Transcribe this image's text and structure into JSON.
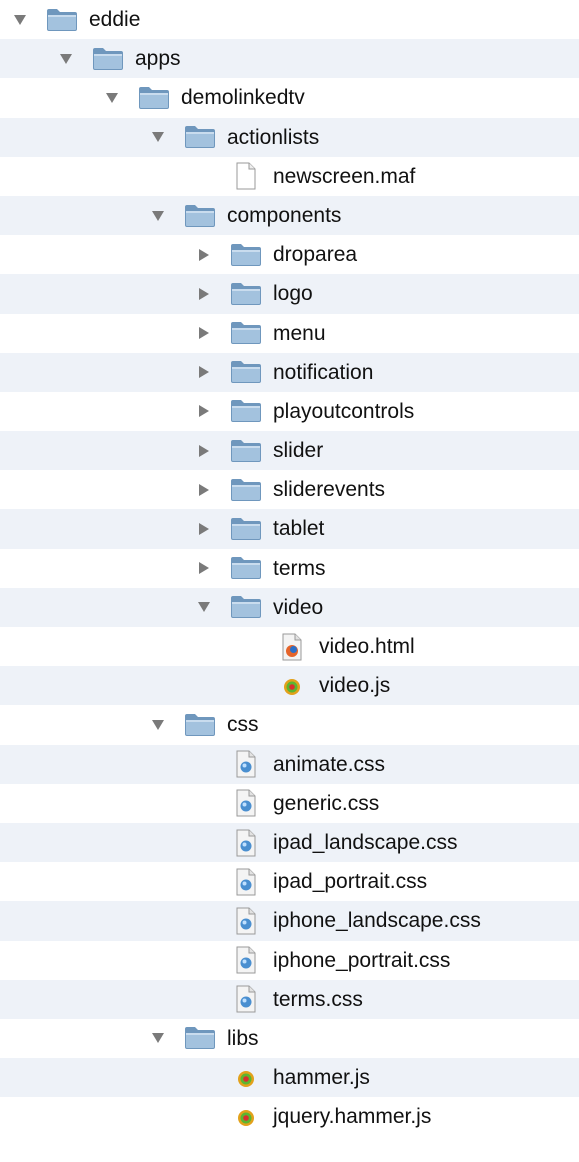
{
  "colors": {
    "row_alternate": "#eef2f8",
    "folder_fill": "#a3c2de",
    "folder_edge": "#6f97bd",
    "disclosure": "#7a7a7a"
  },
  "tree": [
    {
      "label": "eddie",
      "depth": 0,
      "kind": "folder",
      "expanded": true,
      "icon": "folder-icon"
    },
    {
      "label": "apps",
      "depth": 1,
      "kind": "folder",
      "expanded": true,
      "icon": "folder-icon"
    },
    {
      "label": "demolinkedtv",
      "depth": 2,
      "kind": "folder",
      "expanded": true,
      "icon": "folder-icon"
    },
    {
      "label": "actionlists",
      "depth": 3,
      "kind": "folder",
      "expanded": true,
      "icon": "folder-icon"
    },
    {
      "label": "newscreen.maf",
      "depth": 4,
      "kind": "file",
      "icon": "generic-file-icon"
    },
    {
      "label": "components",
      "depth": 3,
      "kind": "folder",
      "expanded": true,
      "icon": "folder-icon"
    },
    {
      "label": "droparea",
      "depth": 4,
      "kind": "folder",
      "expanded": false,
      "icon": "folder-icon"
    },
    {
      "label": "logo",
      "depth": 4,
      "kind": "folder",
      "expanded": false,
      "icon": "folder-icon"
    },
    {
      "label": "menu",
      "depth": 4,
      "kind": "folder",
      "expanded": false,
      "icon": "folder-icon"
    },
    {
      "label": "notification",
      "depth": 4,
      "kind": "folder",
      "expanded": false,
      "icon": "folder-icon"
    },
    {
      "label": "playoutcontrols",
      "depth": 4,
      "kind": "folder",
      "expanded": false,
      "icon": "folder-icon"
    },
    {
      "label": "slider",
      "depth": 4,
      "kind": "folder",
      "expanded": false,
      "icon": "folder-icon"
    },
    {
      "label": "sliderevents",
      "depth": 4,
      "kind": "folder",
      "expanded": false,
      "icon": "folder-icon"
    },
    {
      "label": "tablet",
      "depth": 4,
      "kind": "folder",
      "expanded": false,
      "icon": "folder-icon"
    },
    {
      "label": "terms",
      "depth": 4,
      "kind": "folder",
      "expanded": false,
      "icon": "folder-icon"
    },
    {
      "label": "video",
      "depth": 4,
      "kind": "folder",
      "expanded": true,
      "icon": "folder-icon"
    },
    {
      "label": "video.html",
      "depth": 5,
      "kind": "file",
      "icon": "html-file-icon"
    },
    {
      "label": "video.js",
      "depth": 5,
      "kind": "file",
      "icon": "js-file-icon"
    },
    {
      "label": "css",
      "depth": 3,
      "kind": "folder",
      "expanded": true,
      "icon": "folder-icon"
    },
    {
      "label": "animate.css",
      "depth": 4,
      "kind": "file",
      "icon": "css-file-icon"
    },
    {
      "label": "generic.css",
      "depth": 4,
      "kind": "file",
      "icon": "css-file-icon"
    },
    {
      "label": "ipad_landscape.css",
      "depth": 4,
      "kind": "file",
      "icon": "css-file-icon"
    },
    {
      "label": "ipad_portrait.css",
      "depth": 4,
      "kind": "file",
      "icon": "css-file-icon"
    },
    {
      "label": "iphone_landscape.css",
      "depth": 4,
      "kind": "file",
      "icon": "css-file-icon"
    },
    {
      "label": "iphone_portrait.css",
      "depth": 4,
      "kind": "file",
      "icon": "css-file-icon"
    },
    {
      "label": "terms.css",
      "depth": 4,
      "kind": "file",
      "icon": "css-file-icon"
    },
    {
      "label": "libs",
      "depth": 3,
      "kind": "folder",
      "expanded": true,
      "icon": "folder-icon"
    },
    {
      "label": "hammer.js",
      "depth": 4,
      "kind": "file",
      "icon": "js-file-icon"
    },
    {
      "label": "jquery.hammer.js",
      "depth": 4,
      "kind": "file",
      "icon": "js-file-icon"
    }
  ]
}
